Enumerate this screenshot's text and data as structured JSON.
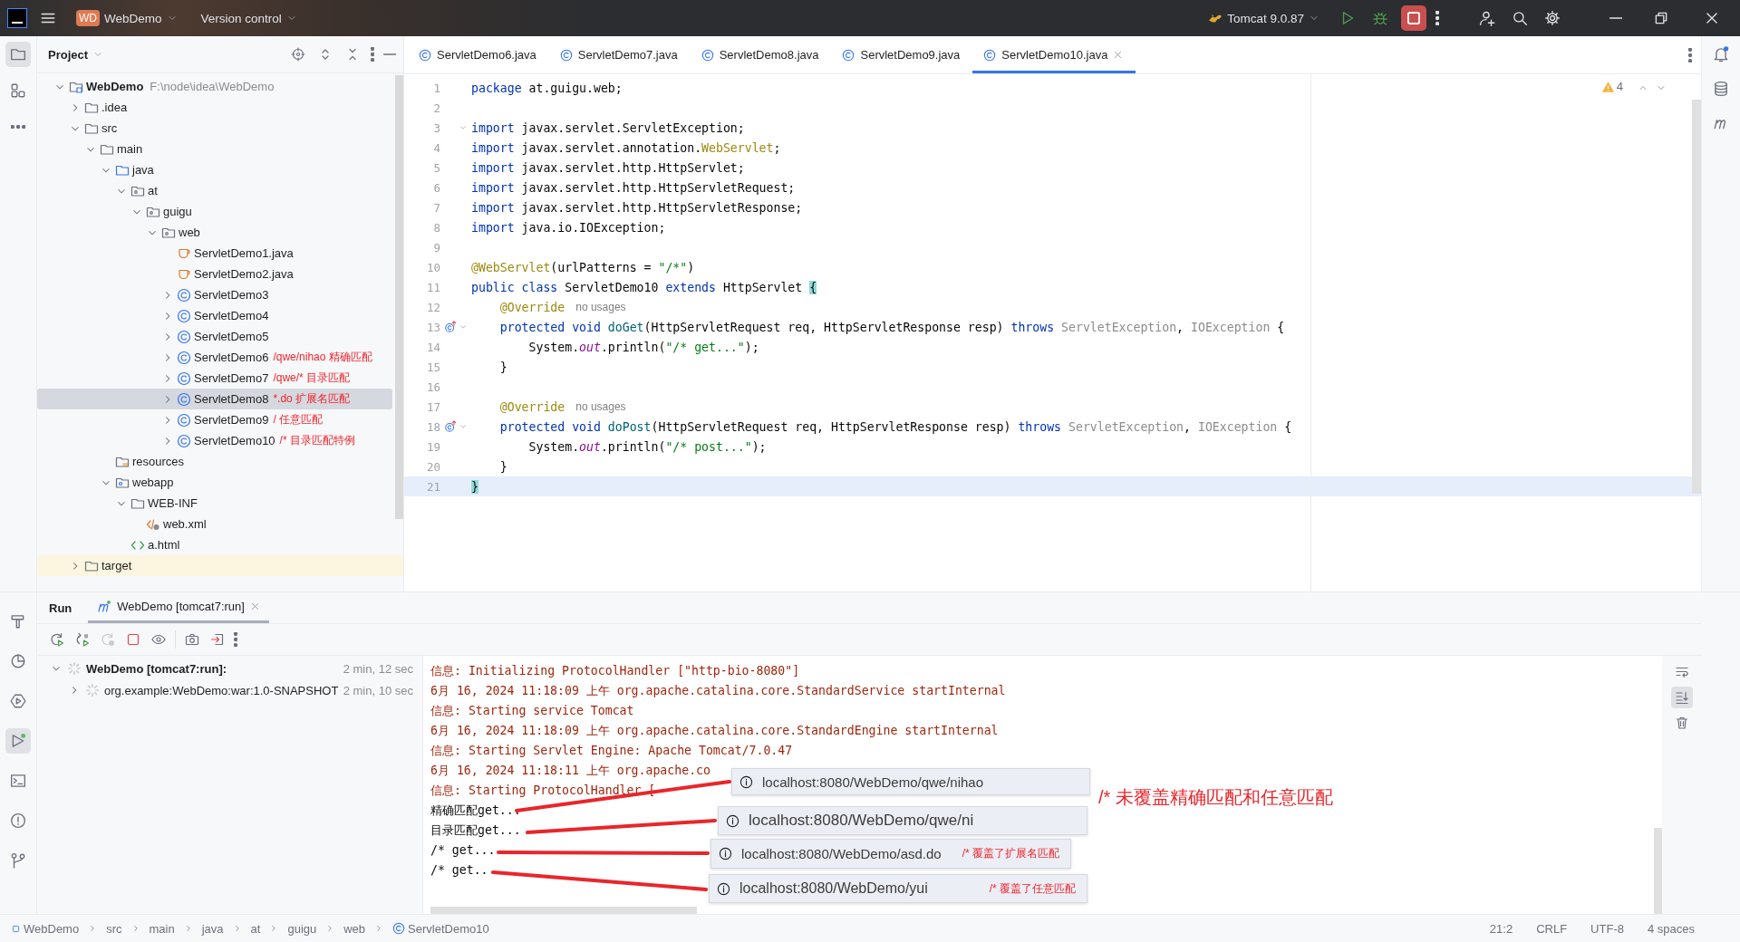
{
  "title_bar": {
    "project_badge": "WD",
    "project": "WebDemo",
    "vcs": "Version control",
    "run_config": "Tomcat 9.0.87"
  },
  "project_panel": {
    "title": "Project",
    "tree": [
      {
        "name": "WebDemo",
        "kind": "module",
        "path": "F:\\node\\idea\\WebDemo",
        "expanded": true,
        "selected": false,
        "children": [
          {
            "name": ".idea",
            "kind": "folder",
            "expanded": false,
            "selected": false,
            "excluded": false
          },
          {
            "name": "src",
            "kind": "folder",
            "expanded": true,
            "selected": false,
            "excluded": false,
            "children": [
              {
                "name": "main",
                "kind": "folder",
                "expanded": true,
                "selected": false,
                "children": [
                  {
                    "name": "java",
                    "kind": "source_folder",
                    "expanded": true,
                    "selected": false,
                    "children": [
                      {
                        "name": "at",
                        "kind": "package",
                        "expanded": true,
                        "selected": false,
                        "children": [
                          {
                            "name": "guigu",
                            "kind": "package",
                            "expanded": true,
                            "selected": false,
                            "children": [
                              {
                                "name": "web",
                                "kind": "package",
                                "expanded": true,
                                "selected": false,
                                "children": [
                                  {
                                    "name": "ServletDemo1.java",
                                    "kind": "java_file",
                                    "selected": false
                                  },
                                  {
                                    "name": "ServletDemo2.java",
                                    "kind": "java_file",
                                    "selected": false
                                  },
                                  {
                                    "name": "ServletDemo3",
                                    "kind": "class",
                                    "expanded": false,
                                    "selected": false
                                  },
                                  {
                                    "name": "ServletDemo4",
                                    "kind": "class",
                                    "expanded": false,
                                    "selected": false
                                  },
                                  {
                                    "name": "ServletDemo5",
                                    "kind": "class",
                                    "expanded": false,
                                    "selected": false
                                  },
                                  {
                                    "name": "ServletDemo6",
                                    "kind": "class",
                                    "expanded": false,
                                    "selected": false,
                                    "note": "/qwe/nihao 精确匹配"
                                  },
                                  {
                                    "name": "ServletDemo7",
                                    "kind": "class",
                                    "expanded": false,
                                    "selected": false,
                                    "note": "/qwe/*  目录匹配"
                                  },
                                  {
                                    "name": "ServletDemo8",
                                    "kind": "class",
                                    "expanded": false,
                                    "selected": true,
                                    "note": "*.do 扩展名匹配"
                                  },
                                  {
                                    "name": "ServletDemo9",
                                    "kind": "class",
                                    "expanded": false,
                                    "selected": false,
                                    "note": "/ 任意匹配"
                                  },
                                  {
                                    "name": "ServletDemo10",
                                    "kind": "class",
                                    "expanded": false,
                                    "selected": false,
                                    "note": "/* 目录匹配特例"
                                  }
                                ]
                              }
                            ]
                          }
                        ]
                      }
                    ]
                  },
                  {
                    "name": "resources",
                    "kind": "resources",
                    "selected": false
                  },
                  {
                    "name": "webapp",
                    "kind": "web_folder",
                    "expanded": true,
                    "selected": false,
                    "children": [
                      {
                        "name": "WEB-INF",
                        "kind": "folder",
                        "expanded": true,
                        "selected": false,
                        "children": [
                          {
                            "name": "web.xml",
                            "kind": "xml",
                            "selected": false
                          }
                        ]
                      },
                      {
                        "name": "a.html",
                        "kind": "html",
                        "selected": false
                      }
                    ]
                  }
                ]
              }
            ]
          },
          {
            "name": "target",
            "kind": "folder",
            "expanded": false,
            "selected": false,
            "excluded": true
          }
        ]
      }
    ]
  },
  "editor": {
    "tabs": [
      {
        "label": "ServletDemo6.java",
        "selected": false
      },
      {
        "label": "ServletDemo7.java",
        "selected": false
      },
      {
        "label": "ServletDemo8.java",
        "selected": false
      },
      {
        "label": "ServletDemo9.java",
        "selected": false
      },
      {
        "label": "ServletDemo10.java",
        "selected": true
      }
    ],
    "warnings": "4",
    "lines": [
      {
        "number": "1",
        "current": false,
        "foldable": false,
        "overrides": false,
        "tokens": [
          {
            "kind": "keyword",
            "text": "package"
          },
          {
            "kind": "plain",
            "text": " at.guigu.web;"
          }
        ]
      },
      {
        "number": "2",
        "current": false,
        "foldable": false,
        "overrides": false
      },
      {
        "number": "3",
        "current": false,
        "foldable": true,
        "overrides": false,
        "tokens": [
          {
            "kind": "keyword",
            "text": "import"
          },
          {
            "kind": "plain",
            "text": " javax.servlet.ServletException;"
          }
        ]
      },
      {
        "number": "4",
        "current": false,
        "foldable": false,
        "overrides": false,
        "tokens": [
          {
            "kind": "keyword",
            "text": "import"
          },
          {
            "kind": "plain",
            "text": " javax.servlet.annotation."
          },
          {
            "kind": "annotation",
            "text": "WebServlet"
          },
          {
            "kind": "plain",
            "text": ";"
          }
        ]
      },
      {
        "number": "5",
        "current": false,
        "foldable": false,
        "overrides": false,
        "tokens": [
          {
            "kind": "keyword",
            "text": "import"
          },
          {
            "kind": "plain",
            "text": " javax.servlet.http.HttpServlet;"
          }
        ]
      },
      {
        "number": "6",
        "current": false,
        "foldable": false,
        "overrides": false,
        "tokens": [
          {
            "kind": "keyword",
            "text": "import"
          },
          {
            "kind": "plain",
            "text": " javax.servlet.http.HttpServletRequest;"
          }
        ]
      },
      {
        "number": "7",
        "current": false,
        "foldable": false,
        "overrides": false,
        "tokens": [
          {
            "kind": "keyword",
            "text": "import"
          },
          {
            "kind": "plain",
            "text": " javax.servlet.http.HttpServletResponse;"
          }
        ]
      },
      {
        "number": "8",
        "current": false,
        "foldable": false,
        "overrides": false,
        "tokens": [
          {
            "kind": "keyword",
            "text": "import"
          },
          {
            "kind": "plain",
            "text": " java.io.IOException;"
          }
        ]
      },
      {
        "number": "9",
        "current": false,
        "foldable": false,
        "overrides": false
      },
      {
        "number": "10",
        "current": false,
        "foldable": false,
        "overrides": false,
        "tokens": [
          {
            "kind": "annotation",
            "text": "@WebServlet"
          },
          {
            "kind": "plain",
            "text": "(urlPatterns = "
          },
          {
            "kind": "string",
            "text": "\"/*\""
          },
          {
            "kind": "plain",
            "text": ")"
          }
        ]
      },
      {
        "number": "11",
        "current": false,
        "foldable": false,
        "overrides": false,
        "tokens": [
          {
            "kind": "keyword",
            "text": "public "
          },
          {
            "kind": "keyword",
            "text": "class "
          },
          {
            "kind": "plain",
            "text": "ServletDemo10 "
          },
          {
            "kind": "keyword",
            "text": "extends "
          },
          {
            "kind": "plain",
            "text": "HttpServlet "
          },
          {
            "kind": "brace",
            "text": "{"
          }
        ]
      },
      {
        "number": "12",
        "current": false,
        "foldable": false,
        "overrides": false,
        "tokens": [
          {
            "kind": "annotation",
            "text": "    @Override"
          }
        ],
        "hint": "no usages"
      },
      {
        "number": "13",
        "current": false,
        "foldable": true,
        "overrides": true,
        "tokens": [
          {
            "kind": "keyword",
            "text": "    protected "
          },
          {
            "kind": "keyword",
            "text": "void "
          },
          {
            "kind": "method",
            "text": "doGet"
          },
          {
            "kind": "plain",
            "text": "(HttpServletRequest req, HttpServletResponse resp) "
          },
          {
            "kind": "keyword",
            "text": "throws "
          },
          {
            "kind": "muted",
            "text": "ServletException"
          },
          {
            "kind": "plain",
            "text": ", "
          },
          {
            "kind": "muted",
            "text": "IOException"
          },
          {
            "kind": "plain",
            "text": " {"
          }
        ]
      },
      {
        "number": "14",
        "current": false,
        "foldable": false,
        "overrides": false,
        "tokens": [
          {
            "kind": "plain",
            "text": "        System."
          },
          {
            "kind": "field",
            "text": "out"
          },
          {
            "kind": "plain",
            "text": ".println("
          },
          {
            "kind": "string",
            "text": "\"/* get...\""
          },
          {
            "kind": "plain",
            "text": ");"
          }
        ]
      },
      {
        "number": "15",
        "current": false,
        "foldable": false,
        "overrides": false,
        "tokens": [
          {
            "kind": "plain",
            "text": "    }"
          }
        ]
      },
      {
        "number": "16",
        "current": false,
        "foldable": false,
        "overrides": false
      },
      {
        "number": "17",
        "current": false,
        "foldable": false,
        "overrides": false,
        "tokens": [
          {
            "kind": "annotation",
            "text": "    @Override"
          }
        ],
        "hint": "no usages"
      },
      {
        "number": "18",
        "current": false,
        "foldable": true,
        "overrides": true,
        "tokens": [
          {
            "kind": "keyword",
            "text": "    protected "
          },
          {
            "kind": "keyword",
            "text": "void "
          },
          {
            "kind": "method",
            "text": "doPost"
          },
          {
            "kind": "plain",
            "text": "(HttpServletRequest req, HttpServletResponse resp) "
          },
          {
            "kind": "keyword",
            "text": "throws "
          },
          {
            "kind": "muted",
            "text": "ServletException"
          },
          {
            "kind": "plain",
            "text": ", "
          },
          {
            "kind": "muted",
            "text": "IOException"
          },
          {
            "kind": "plain",
            "text": " {"
          }
        ]
      },
      {
        "number": "19",
        "current": false,
        "foldable": false,
        "overrides": false,
        "tokens": [
          {
            "kind": "plain",
            "text": "        System."
          },
          {
            "kind": "field",
            "text": "out"
          },
          {
            "kind": "plain",
            "text": ".println("
          },
          {
            "kind": "string",
            "text": "\"/* post...\""
          },
          {
            "kind": "plain",
            "text": ");"
          }
        ]
      },
      {
        "number": "20",
        "current": false,
        "foldable": false,
        "overrides": false,
        "tokens": [
          {
            "kind": "plain",
            "text": "    }"
          }
        ]
      },
      {
        "number": "21",
        "current": true,
        "foldable": false,
        "overrides": false,
        "tokens": [
          {
            "kind": "brace",
            "text": "}"
          }
        ]
      }
    ]
  },
  "run_panel": {
    "title": "Run",
    "tabs": [
      {
        "label": "WebDemo [tomcat7:run]",
        "selected": true
      }
    ],
    "tree": [
      {
        "name": "WebDemo [tomcat7:run]:",
        "time": "2 min, 12 sec",
        "expanded": true,
        "children": [
          {
            "name": "org.example:WebDemo:war:1.0-SNAPSHOT",
            "time": "2 min, 10 sec",
            "expanded": false
          }
        ]
      }
    ],
    "console": [
      {
        "kind": "log",
        "text": "信息: Initializing ProtocolHandler [\"http-bio-8080\"]"
      },
      {
        "kind": "log",
        "text": "6月 16, 2024 11:18:09 上午 org.apache.catalina.core.StandardService startInternal"
      },
      {
        "kind": "log",
        "text": "信息: Starting service Tomcat"
      },
      {
        "kind": "log",
        "text": "6月 16, 2024 11:18:09 上午 org.apache.catalina.core.StandardEngine startInternal"
      },
      {
        "kind": "log",
        "text": "信息: Starting Servlet Engine: Apache Tomcat/7.0.47"
      },
      {
        "kind": "log",
        "text": "6月 16, 2024 11:18:11 上午 org.apache.co"
      },
      {
        "kind": "log",
        "text": "信息: Starting ProtocolHandler ["
      },
      {
        "kind": "output",
        "text": "精确匹配get..."
      },
      {
        "kind": "output",
        "text": "目录匹配get..."
      },
      {
        "kind": "output",
        "text": "/* get..."
      },
      {
        "kind": "output",
        "text": "/* get.."
      }
    ],
    "overlays": [
      {
        "url": "localhost:8080/WebDemo/qwe/nihao"
      },
      {
        "url": "localhost:8080/WebDemo/qwe/ni"
      },
      {
        "url": "localhost:8080/WebDemo/asd.do",
        "note": "/* 覆盖了扩展名匹配"
      },
      {
        "url": "localhost:8080/WebDemo/yui",
        "note": "/* 覆盖了任意匹配"
      }
    ],
    "callout": "/* 未覆盖精确匹配和任意匹配"
  },
  "status_bar": {
    "breadcrumbs": [
      "WebDemo",
      "src",
      "main",
      "java",
      "at",
      "guigu",
      "web",
      "ServletDemo10"
    ],
    "position": "21:2",
    "line_separator": "CRLF",
    "encoding": "UTF-8",
    "indent": "4 spaces"
  }
}
